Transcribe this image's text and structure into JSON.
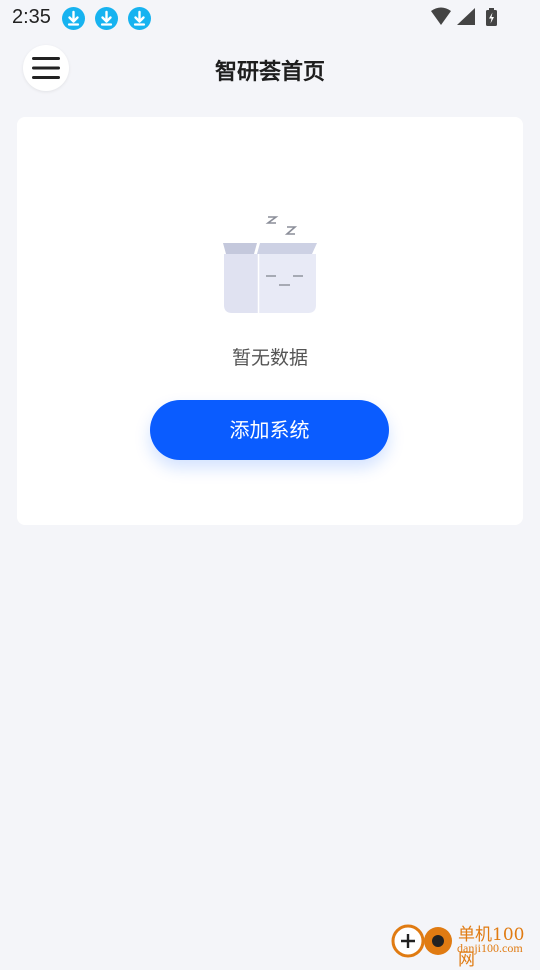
{
  "status_bar": {
    "time": "2:35",
    "notification_icons": [
      "download-icon",
      "download-icon",
      "download-icon"
    ],
    "system_icons": [
      "wifi-icon",
      "cellular-signal-icon",
      "battery-charging-icon"
    ]
  },
  "header": {
    "menu_icon": "hamburger-menu-icon",
    "title": "智研荟首页"
  },
  "card": {
    "illustration": "empty-box-icon",
    "empty_text": "暂无数据",
    "add_button_label": "添加系统"
  },
  "watermark": {
    "brand": "单机100网",
    "url": "danji100.com"
  },
  "colors": {
    "background": "#f4f5f9",
    "card": "#ffffff",
    "accent": "#0a5cff",
    "download_badge": "#17b3f0",
    "watermark": "#e07b12"
  }
}
